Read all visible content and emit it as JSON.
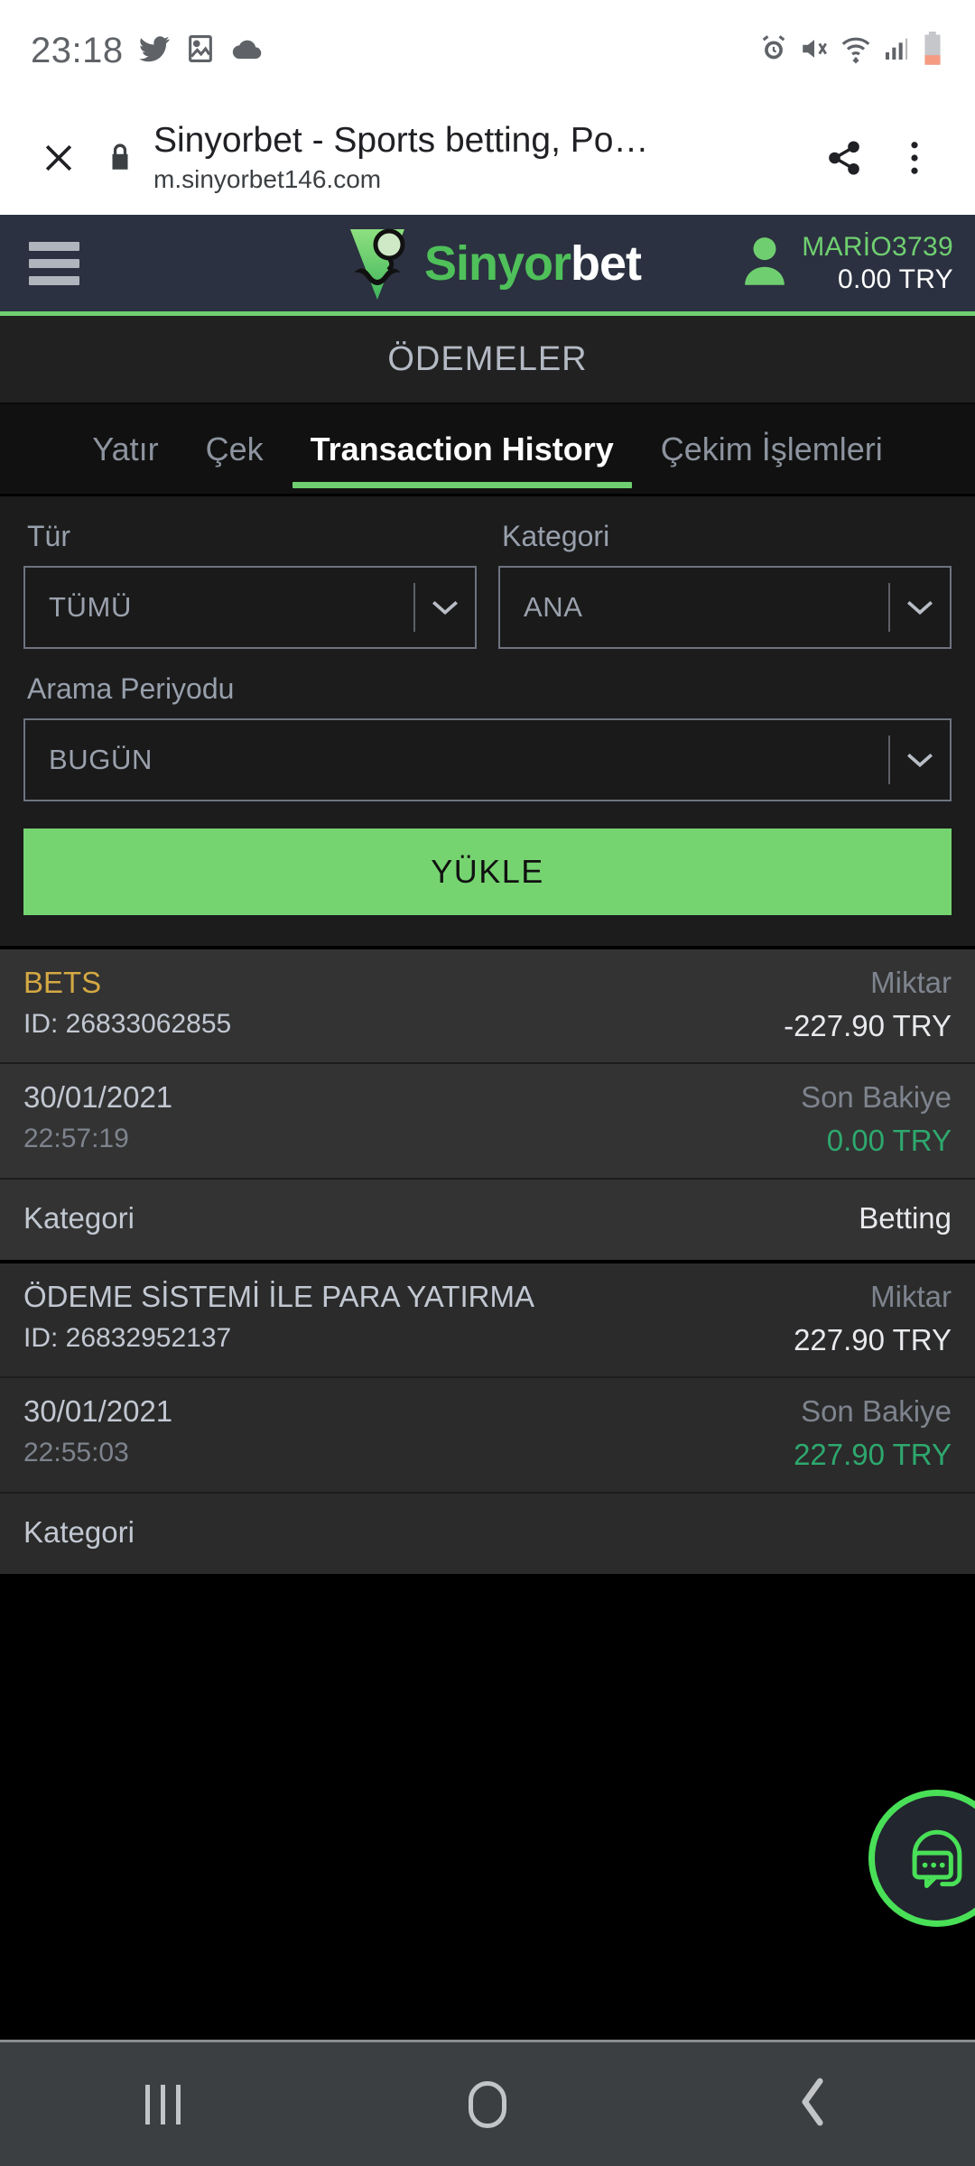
{
  "status_bar": {
    "time": "23:18",
    "left_icons": [
      "twitter-icon",
      "image-icon",
      "cloud-icon"
    ],
    "right_icons": [
      "alarm-icon",
      "vibrate-mute-icon",
      "wifi-icon",
      "signal-icon",
      "battery-low-icon"
    ]
  },
  "browser_bar": {
    "close_label": "✕",
    "security_icon": "lock-icon",
    "page_title": "Sinyorbet - Sports betting, Po…",
    "url": "m.sinyorbet146.com",
    "share_icon": "share-icon",
    "menu_icon": "overflow-menu-icon"
  },
  "site_header": {
    "menu_icon": "hamburger-icon",
    "brand_part1": "Sinyor",
    "brand_part2": "bet",
    "avatar_icon": "user-avatar-icon",
    "username": "MARİO3739",
    "balance": "0.00 TRY",
    "accent_green": "#6fcf70",
    "header_bg": "#2b3140"
  },
  "page": {
    "title": "ÖDEMELER"
  },
  "tabs": [
    {
      "label": "Yatır",
      "active": false
    },
    {
      "label": "Çek",
      "active": false
    },
    {
      "label": "Transaction History",
      "active": true
    },
    {
      "label": "Çekim İşlemleri",
      "active": false
    }
  ],
  "filters": {
    "type_label": "Tür",
    "type_value": "TÜMÜ",
    "category_label": "Kategori",
    "category_value": "ANA",
    "period_label": "Arama Periyodu",
    "period_value": "BUGÜN",
    "submit_label": "YÜKLE",
    "submit_color": "#75d470"
  },
  "transactions": [
    {
      "title": "BETS",
      "title_color": "gold",
      "id": "ID: 26833062855",
      "amount_label": "Miktar",
      "amount": "-227.90 TRY",
      "date": "30/01/2021",
      "time": "22:57:19",
      "balance_label": "Son Bakiye",
      "balance": "0.00 TRY",
      "category_label": "Kategori",
      "category_value": "Betting"
    },
    {
      "title": "ÖDEME SİSTEMİ İLE PARA YATIRMA",
      "title_color": "light",
      "id": "ID: 26832952137",
      "amount_label": "Miktar",
      "amount": "227.90 TRY",
      "date": "30/01/2021",
      "time": "22:55:03",
      "balance_label": "Son Bakiye",
      "balance": "227.90 TRY",
      "category_label": "Kategori",
      "category_value": ""
    }
  ],
  "live_chat": {
    "icon": "headset-chat-icon",
    "color": "#49e057"
  },
  "nav_bar": {
    "recents_icon": "recents-icon",
    "home_icon": "home-icon",
    "back_icon": "back-icon"
  }
}
